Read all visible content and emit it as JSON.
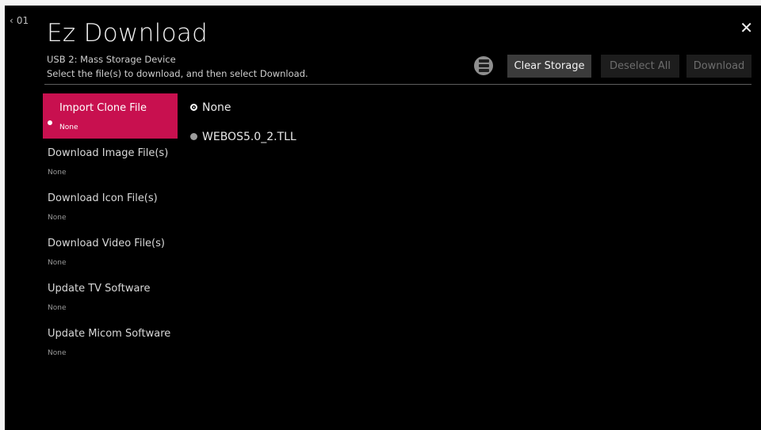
{
  "header": {
    "back_label": "01",
    "title": "Ez Download",
    "device": "USB 2: Mass Storage Device",
    "instruction": "Select the file(s) to download, and then select Download."
  },
  "toolbar": {
    "storage_icon": "storage-icon",
    "clear_label": "Clear Storage",
    "deselect_label": "Deselect All",
    "download_label": "Download"
  },
  "menu": {
    "items": [
      {
        "label": "Import Clone File",
        "value": "None",
        "selected": true
      },
      {
        "label": "Download Image File(s)",
        "value": "None",
        "selected": false
      },
      {
        "label": "Download Icon File(s)",
        "value": "None",
        "selected": false
      },
      {
        "label": "Download Video File(s)",
        "value": "None",
        "selected": false
      },
      {
        "label": "Update TV Software",
        "value": "None",
        "selected": false
      },
      {
        "label": "Update Micom Software",
        "value": "None",
        "selected": false
      }
    ]
  },
  "options": [
    {
      "label": "None",
      "checked": true
    },
    {
      "label": "WEBOS5.0_2.TLL",
      "checked": false
    }
  ],
  "colors": {
    "accent": "#c8104f",
    "background": "#000000"
  }
}
